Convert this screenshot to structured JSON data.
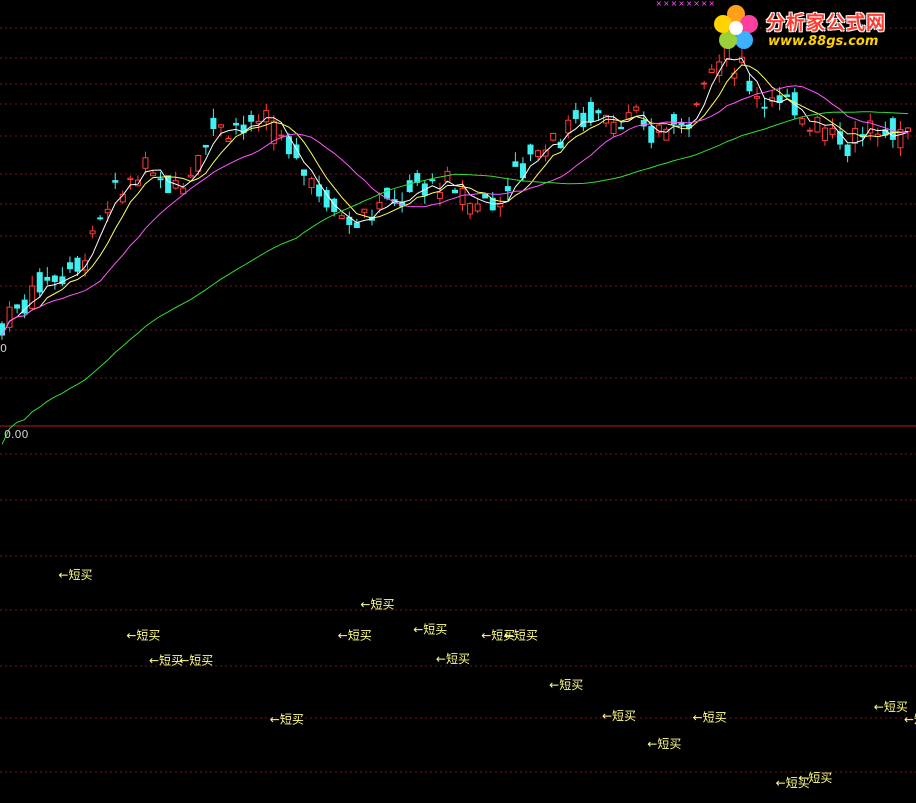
{
  "logo": {
    "title": "分析家公式网",
    "url": "www.88gs.com"
  },
  "axis": {
    "upper_edge_label": "0",
    "lower_zero_label": "0.00"
  },
  "colors": {
    "background": "#000000",
    "grid": "#7a1515",
    "divider": "#b01e1e",
    "candle_up": "#ff3b3b",
    "candle_down": "#40f0f0",
    "ma_fast": "#ffffff",
    "ma_mid": "#ffff66",
    "ma_slow": "#ff55ff",
    "ma_long": "#33dd33",
    "signal_text": "#ffff88",
    "marker": "#ff55ff"
  },
  "chart_data": {
    "type": "candlestick",
    "price_panel": {
      "series": [
        {
          "name": "",
          "kind": "candles",
          "count": 121
        },
        {
          "name": "",
          "kind": "moving-average",
          "color": "#ffffff"
        },
        {
          "name": "",
          "kind": "moving-average",
          "color": "#ffff66"
        },
        {
          "name": "",
          "kind": "moving-average",
          "color": "#ff55ff"
        },
        {
          "name": "",
          "kind": "moving-average",
          "color": "#33dd33"
        }
      ],
      "top_markers": {
        "symbol": "×",
        "count": 8,
        "bar_start": 87
      }
    },
    "indicator_panel": {
      "signal_label": "←短买",
      "signals": [
        {
          "bar": 8,
          "level": 0.93
        },
        {
          "bar": 17,
          "level": 0.54
        },
        {
          "bar": 20,
          "level": 0.38
        },
        {
          "bar": 24,
          "level": 0.38
        },
        {
          "bar": 36,
          "level": 0.0
        },
        {
          "bar": 45,
          "level": 0.54
        },
        {
          "bar": 48,
          "level": 0.74
        },
        {
          "bar": 55,
          "level": 0.58
        },
        {
          "bar": 58,
          "level": 0.39
        },
        {
          "bar": 64,
          "level": 0.54
        },
        {
          "bar": 67,
          "level": 0.54
        },
        {
          "bar": 73,
          "level": 0.22
        },
        {
          "bar": 80,
          "level": 0.02
        },
        {
          "bar": 86,
          "level": -0.16
        },
        {
          "bar": 92,
          "level": 0.01
        },
        {
          "bar": 103,
          "level": -0.41
        },
        {
          "bar": 106,
          "level": -0.38
        },
        {
          "bar": 116,
          "level": 0.08
        },
        {
          "bar": 120,
          "level": 0.0
        }
      ]
    }
  }
}
